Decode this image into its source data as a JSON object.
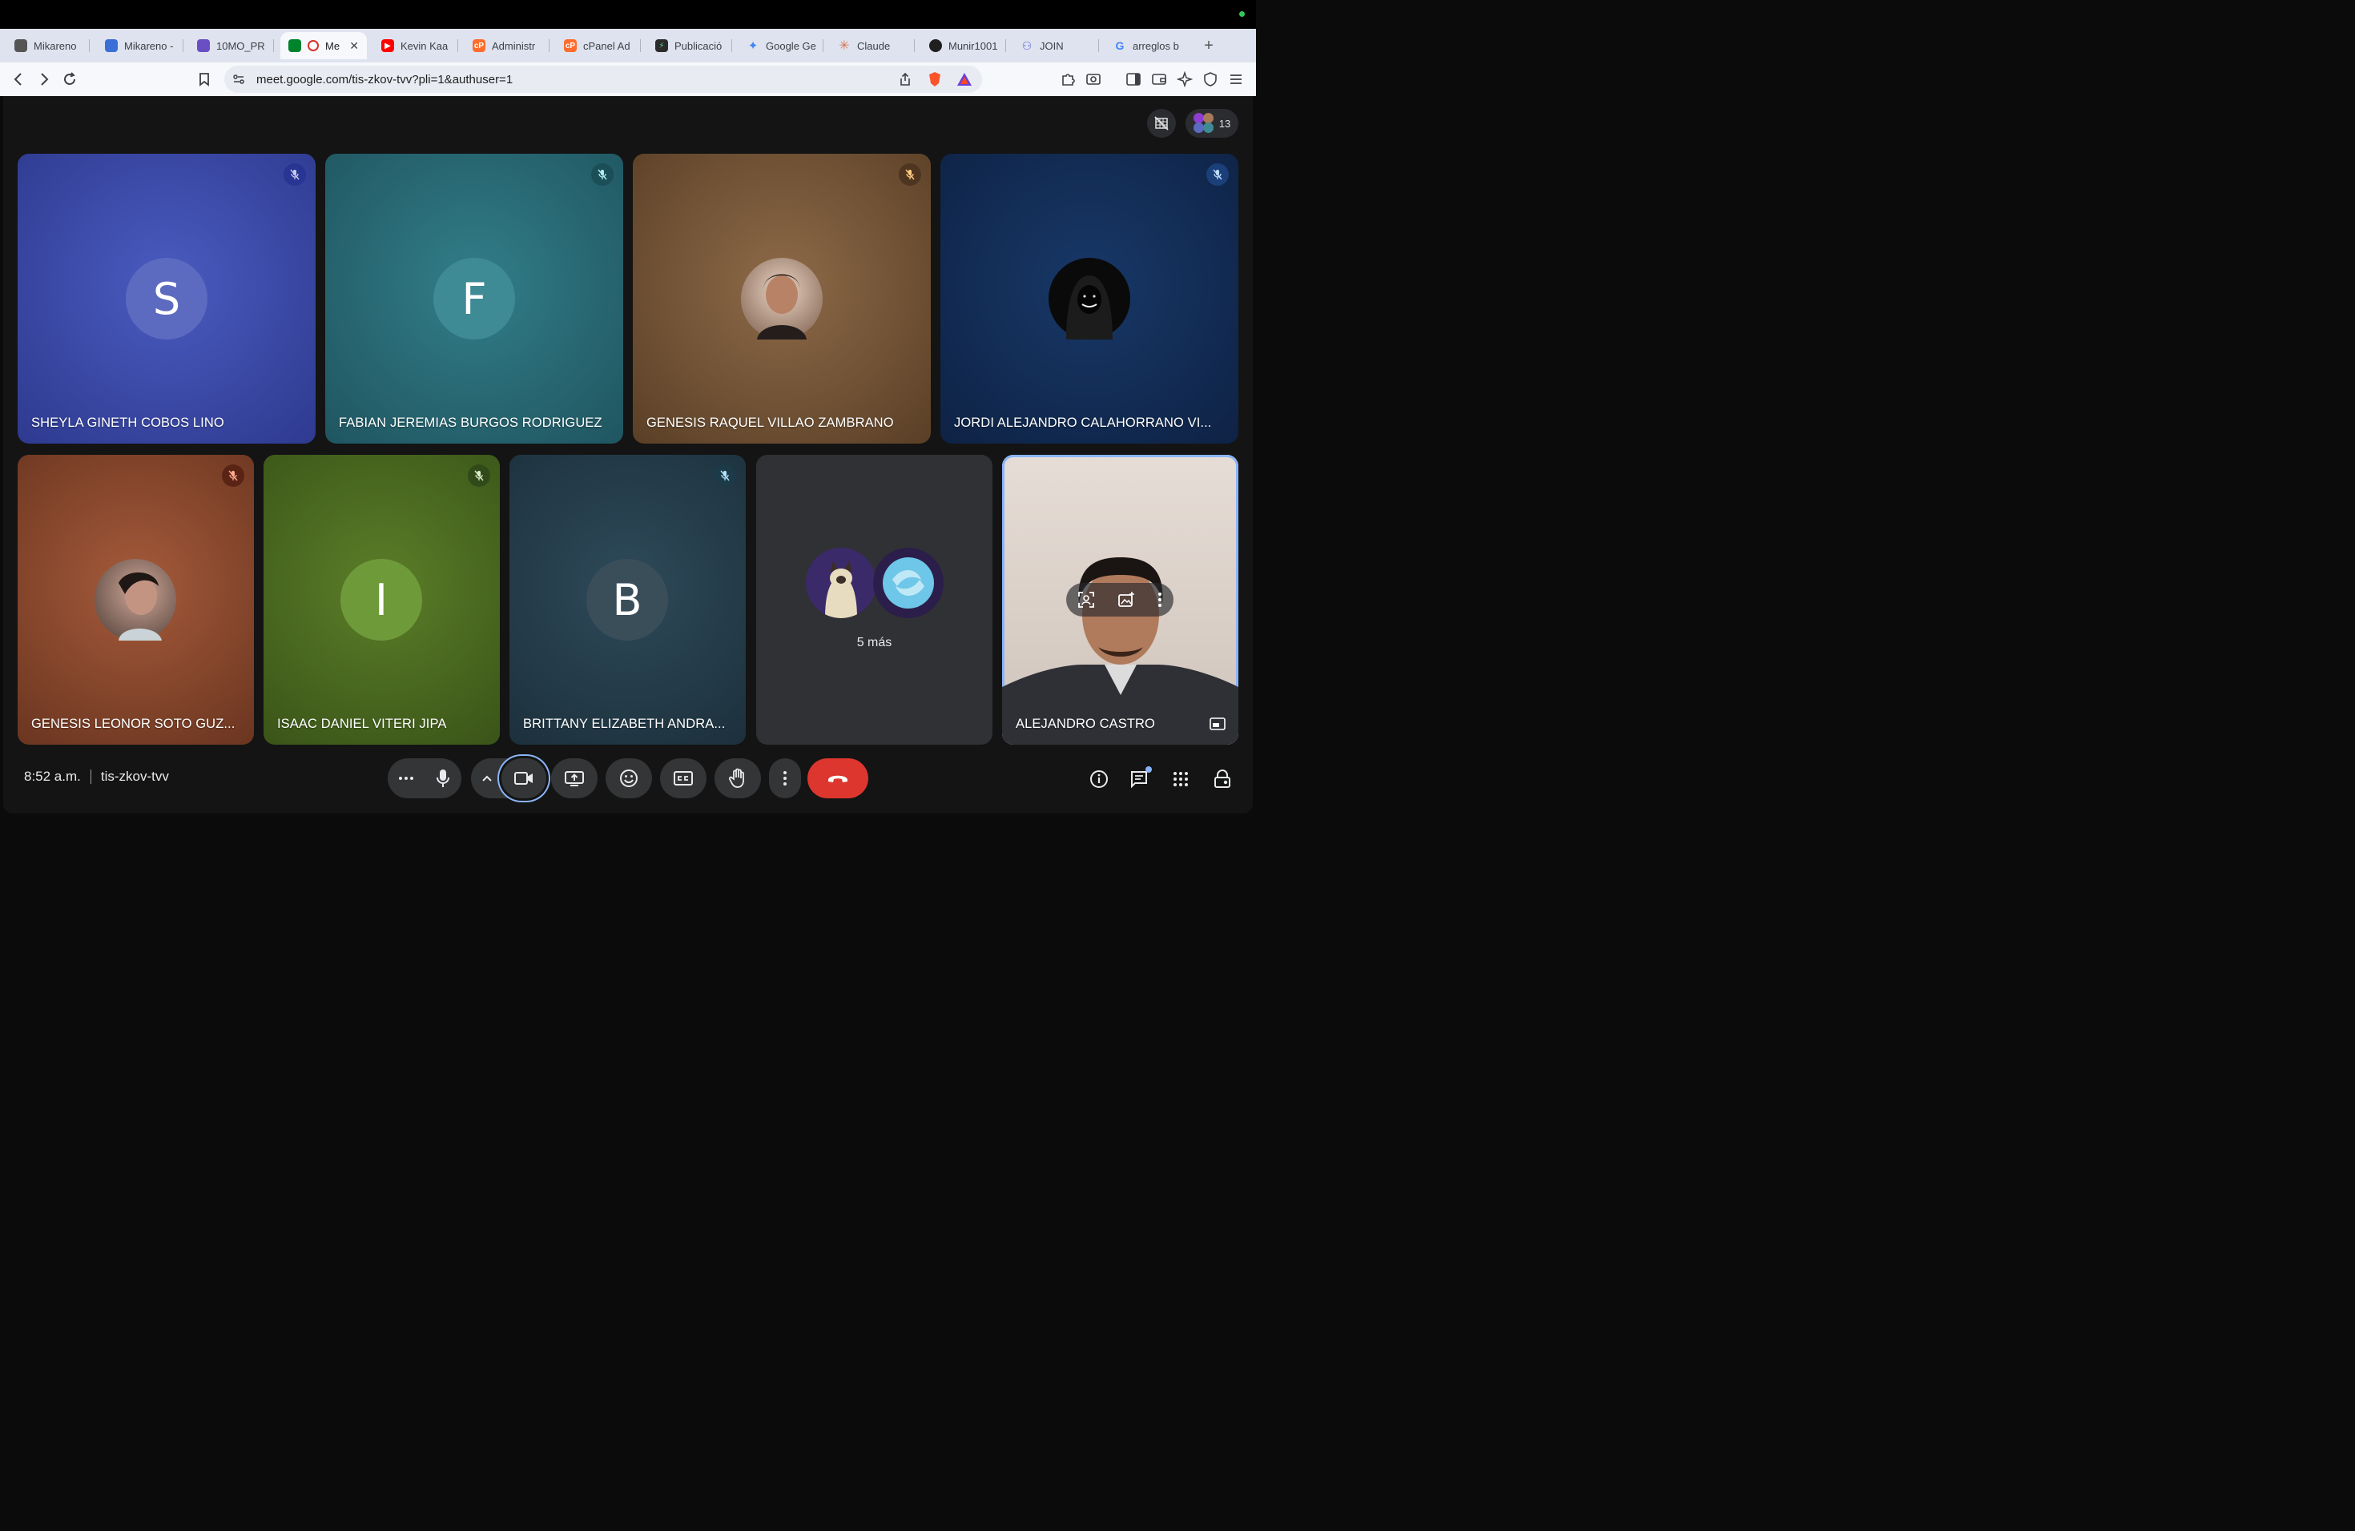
{
  "browser": {
    "tabs": [
      {
        "label": "Mikareno",
        "color": "#555555"
      },
      {
        "label": "Mikareno -",
        "color": "#3b6fd8"
      },
      {
        "label": "10MO_PR",
        "color": "#6a4fc4"
      },
      {
        "label": "Me",
        "color": "#00832d",
        "active": true
      },
      {
        "label": "Kevin Kaa",
        "color": "#ff0000"
      },
      {
        "label": "Administr",
        "color": "#ff6c2c"
      },
      {
        "label": "cPanel Ad",
        "color": "#ff6c2c"
      },
      {
        "label": "Publicació",
        "color": "#2b2b2b"
      },
      {
        "label": "Google Ge",
        "color": "#4285f4"
      },
      {
        "label": "Claude",
        "color": "#d97757"
      },
      {
        "label": "Munir1001",
        "color": "#1f1f1f"
      },
      {
        "label": "JOIN",
        "color": "#5b6bd6"
      },
      {
        "label": "arreglos b",
        "color": "#4285f4"
      }
    ],
    "new_tab": "+",
    "url": "meet.google.com/tis-zkov-tvv?pli=1&authuser=1"
  },
  "meet": {
    "participant_count": "13",
    "participants": [
      {
        "name": "SHEYLA GINETH COBOS LINO",
        "initial": "S",
        "bg": "#3b4aa8",
        "avatar_bg": "#5c6bc0",
        "mic_bg": "#283593"
      },
      {
        "name": "FABIAN JEREMIAS BURGOS RODRIGUEZ",
        "initial": "F",
        "bg": "#2a6a75",
        "avatar_bg": "#3e8a95",
        "mic_bg": "#1b4e57"
      },
      {
        "name": "GENESIS RAQUEL VILLAO ZAMBRANO",
        "initial": "",
        "bg": "#7a5a3a",
        "avatar_bg": "#c9a48a",
        "mic_bg": "#4e3520"
      },
      {
        "name": "JORDI ALEJANDRO CALAHORRANO VI...",
        "initial": "",
        "bg": "#14305a",
        "avatar_bg": "#0a0a0a",
        "mic_bg": "#1b3f78"
      },
      {
        "name": "GENESIS LEONOR SOTO GUZ...",
        "initial": "",
        "bg": "#8a4a30",
        "avatar_bg": "#b88a7a",
        "mic_bg": "#5a2414"
      },
      {
        "name": "ISAAC DANIEL VITERI JIPA",
        "initial": "I",
        "bg": "#4e6e22",
        "avatar_bg": "#6f9a3a",
        "mic_bg": "#32491a"
      },
      {
        "name": "BRITTANY ELIZABETH ANDRA...",
        "initial": "B",
        "bg": "#28404e",
        "avatar_bg": "#3a4e5a",
        "mic_bg": "#1c3a48"
      },
      {
        "name": "",
        "initial": "",
        "bg": "#303134",
        "avatar_bg": "",
        "mic_bg": ""
      },
      {
        "name": "ALEJANDRO CASTRO",
        "initial": "",
        "bg": "#d9d2cc",
        "avatar_bg": "",
        "mic_bg": ""
      }
    ],
    "more_label": "5 más",
    "time": "8:52 a.m.",
    "meeting_code": "tis-zkov-tvv",
    "accent": "#8ab4f8",
    "end_call_color": "#dc362e"
  }
}
